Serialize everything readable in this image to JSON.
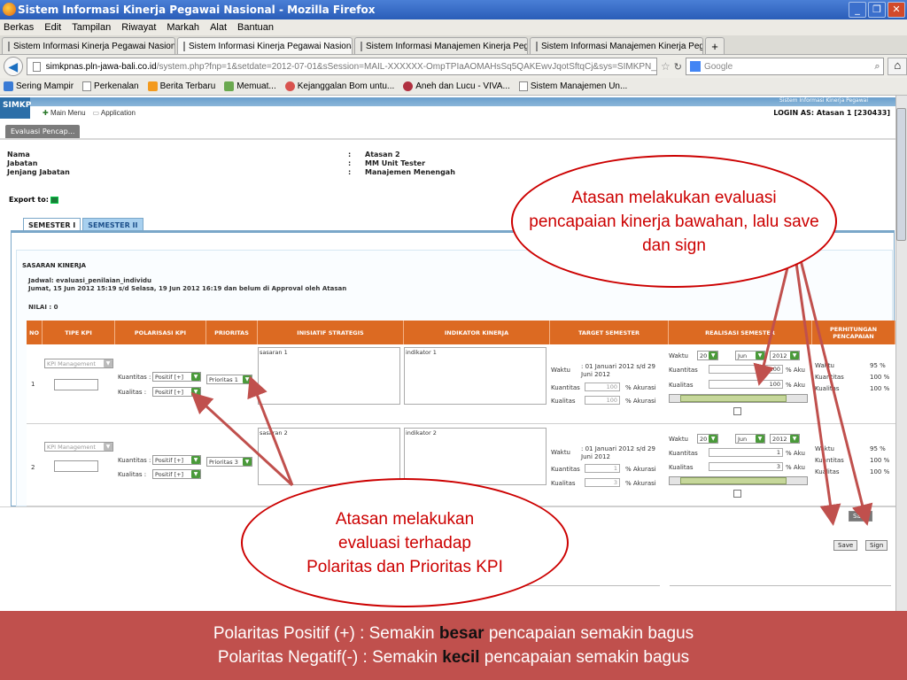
{
  "window": {
    "title": "Sistem Informasi Kinerja Pegawai Nasional - Mozilla Firefox",
    "controls": [
      "_",
      "❐",
      "✕"
    ]
  },
  "menu": [
    "Berkas",
    "Edit",
    "Tampilan",
    "Riwayat",
    "Markah",
    "Alat",
    "Bantuan"
  ],
  "tabs": [
    {
      "label": "Sistem Informasi Kinerja Pegawai Nasional",
      "active": false
    },
    {
      "label": "Sistem Informasi Kinerja Pegawai Nasional",
      "active": true
    },
    {
      "label": "Sistem Informasi Manajemen Kinerja Peg...",
      "active": false
    },
    {
      "label": "Sistem Informasi Manajemen Kinerja Peg...",
      "active": false
    }
  ],
  "nav": {
    "url_host": "simkpnas.pln-jawa-bali.co.id",
    "url_rest": "/system.php?fnp=1&setdate=2012-07-01&sSession=MAIL-XXXXXX-OmpTPIaAOMAHsSq5QAKEwvJqotSftqCj&sys=SIMKPN_Target_Mentor&sub",
    "search_placeholder": "Google"
  },
  "bookmarks": [
    "Sering Mampir",
    "Perkenalan",
    "Berita Terbaru",
    "Memuat...",
    "Kejanggalan Bom untu...",
    "Aneh dan Lucu - VIVA...",
    "Sistem Manajemen Un..."
  ],
  "app": {
    "logo": "SIMKP",
    "strip_text": "Sistem Informasi Kinerja Pegawai",
    "main_menu": "Main Menu",
    "application": "Application",
    "login": "LOGIN AS: Atasan 1 [230433]",
    "eval_tab": "Evaluasi Pencap...",
    "info_labels": [
      "Nama",
      "Jabatan",
      "Jenjang Jabatan"
    ],
    "info_values": [
      "Atasan 2",
      "MM Unit Tester",
      "Manajemen Menengah"
    ],
    "export_to": "Export to:",
    "semesters": [
      "SEMESTER I",
      "SEMESTER II"
    ],
    "section": "SASARAN KINERJA",
    "jadwal_line1": "Jadwal: evaluasi_penilaian_individu",
    "jadwal_line2": "Jumat, 15 Jun 2012 15:19 s/d Selasa, 19 Jun 2012 16:19 dan belum di Approval oleh Atasan",
    "nilai": "NILAI : 0",
    "columns": [
      "NO",
      "TIPE KPI",
      "POLARISASI KPI",
      "PRIORITAS",
      "INISIATIF STRATEGIS",
      "INDIKATOR KINERJA",
      "TARGET SEMESTER",
      "REALISASI SEMESTER",
      "PERHITUNGAN PENCAPAIAN"
    ],
    "rows": [
      {
        "no": "1",
        "tipe": "KPI Management",
        "kuantitas_label": "Kuantitas :",
        "kuantitas_val": "Positif [+]",
        "kualitas_label": "Kualitas :",
        "kualitas_val": "Positif [+]",
        "prioritas": "Prioritas 1",
        "inisiatif": "sasaran 1",
        "indikator": "indikator 1",
        "target_waktu": "01 Januari 2012 s/d 29 Juni 2012",
        "target_kuantitas": "100",
        "target_kualitas": "100",
        "real_tgl": "20",
        "real_bln": "Jun",
        "real_thn": "2012",
        "real_kuantitas": "100",
        "real_kualitas": "100",
        "hit_kuantitas": "100 %",
        "hit_kualitas": "100 %",
        "hit_waktu": "95 %"
      },
      {
        "no": "2",
        "tipe": "KPI Management",
        "kuantitas_label": "Kuantitas :",
        "kuantitas_val": "Positif [+]",
        "kualitas_label": "Kualitas :",
        "kualitas_val": "Positif [+]",
        "prioritas": "Prioritas 3",
        "inisiatif": "sasaran 2",
        "indikator": "indikator 2",
        "target_waktu": "01 Januari 2012 s/d 29 Juni 2012",
        "target_kuantitas": "1",
        "target_kualitas": "3",
        "real_tgl": "20",
        "real_bln": "Jun",
        "real_thn": "2012",
        "real_kuantitas": "1",
        "real_kualitas": "3",
        "hit_kuantitas": "100 %",
        "hit_kualitas": "100 %",
        "hit_waktu": "95 %"
      }
    ],
    "lbl_waktu": "Waktu",
    "lbl_kuantitas": "Kuantitas",
    "lbl_kualitas": "Kualitas",
    "lbl_akurasi": "% Akurasi",
    "lbl_aku": "% Aku",
    "save": "Save",
    "sign": "Sign",
    "save_top": "Save"
  },
  "callouts": {
    "top": "Atasan melakukan evaluasi pencapaian kinerja bawahan, lalu save dan sign",
    "bottom": "Atasan melakukan evaluasi terhadap Polaritas dan Prioritas KPI"
  },
  "footer": {
    "line1_pre": "Polaritas Positif (+) : Semakin ",
    "line1_bold": "besar",
    "line1_post": " pencapaian semakin bagus",
    "line2_pre": "Polaritas Negatif(-) : Semakin ",
    "line2_bold": "kecil",
    "line2_post": " pencapaian semakin bagus"
  },
  "colors": {
    "accent_orange": "#dc6a22",
    "footer_red": "#c0504d",
    "callout_red": "#cc0000"
  }
}
